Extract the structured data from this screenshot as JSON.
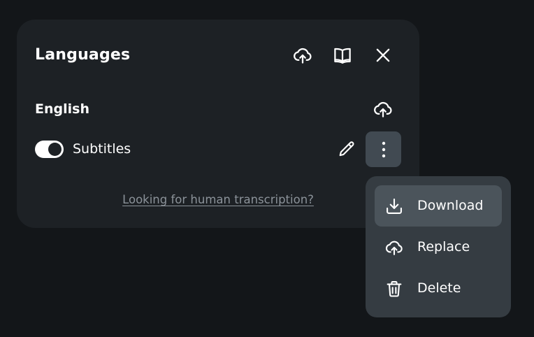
{
  "panel": {
    "title": "Languages",
    "header_icons": [
      "cloud-upload-icon",
      "book-icon",
      "close-icon"
    ]
  },
  "language": {
    "name": "English",
    "track": {
      "label": "Subtitles",
      "enabled": true
    }
  },
  "help_link": "Looking for human transcription?",
  "menu": {
    "items": [
      {
        "label": "Download",
        "icon": "download-icon",
        "highlighted": true
      },
      {
        "label": "Replace",
        "icon": "cloud-upload-icon",
        "highlighted": false
      },
      {
        "label": "Delete",
        "icon": "trash-icon",
        "highlighted": false
      }
    ]
  },
  "colors": {
    "background": "#131619",
    "panel": "#1d2125",
    "menu": "#353c42",
    "menu_highlight": "#4b545b",
    "button_active": "#414a52",
    "link": "#8b9299"
  }
}
